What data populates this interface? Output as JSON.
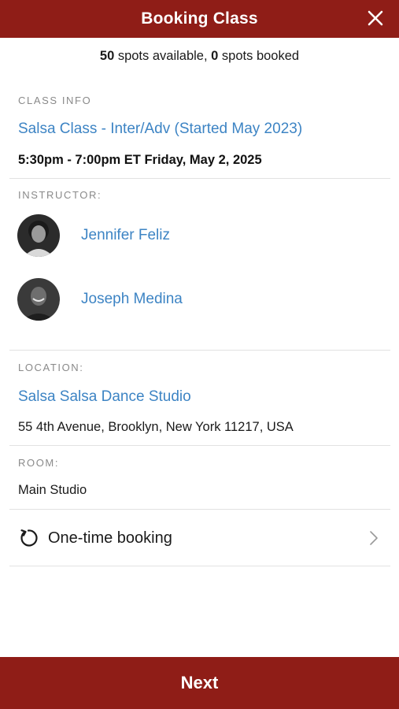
{
  "header": {
    "title": "Booking Class",
    "close_icon": "close-icon"
  },
  "spots": {
    "available_count": "50",
    "available_text": " spots available, ",
    "booked_count": "0",
    "booked_text": " spots booked"
  },
  "class_info": {
    "label": "CLASS INFO",
    "class_name": "Salsa Class - Inter/Adv (Started May 2023)",
    "schedule": "5:30pm - 7:00pm ET Friday, May 2, 2025"
  },
  "instructor": {
    "label": "INSTRUCTOR:",
    "items": [
      {
        "name": "Jennifer Feliz"
      },
      {
        "name": "Joseph Medina"
      }
    ]
  },
  "location": {
    "label": "LOCATION:",
    "name": "Salsa Salsa Dance Studio",
    "address": "55 4th Avenue, Brooklyn, New York 11217, USA"
  },
  "room": {
    "label": "ROOM:",
    "name": "Main Studio"
  },
  "booking": {
    "label": "One-time booking",
    "icon": "refresh-icon"
  },
  "footer": {
    "next_label": "Next"
  },
  "colors": {
    "brand": "#8f1d17",
    "link": "#3d84c4",
    "label_gray": "#8a8a8a"
  }
}
